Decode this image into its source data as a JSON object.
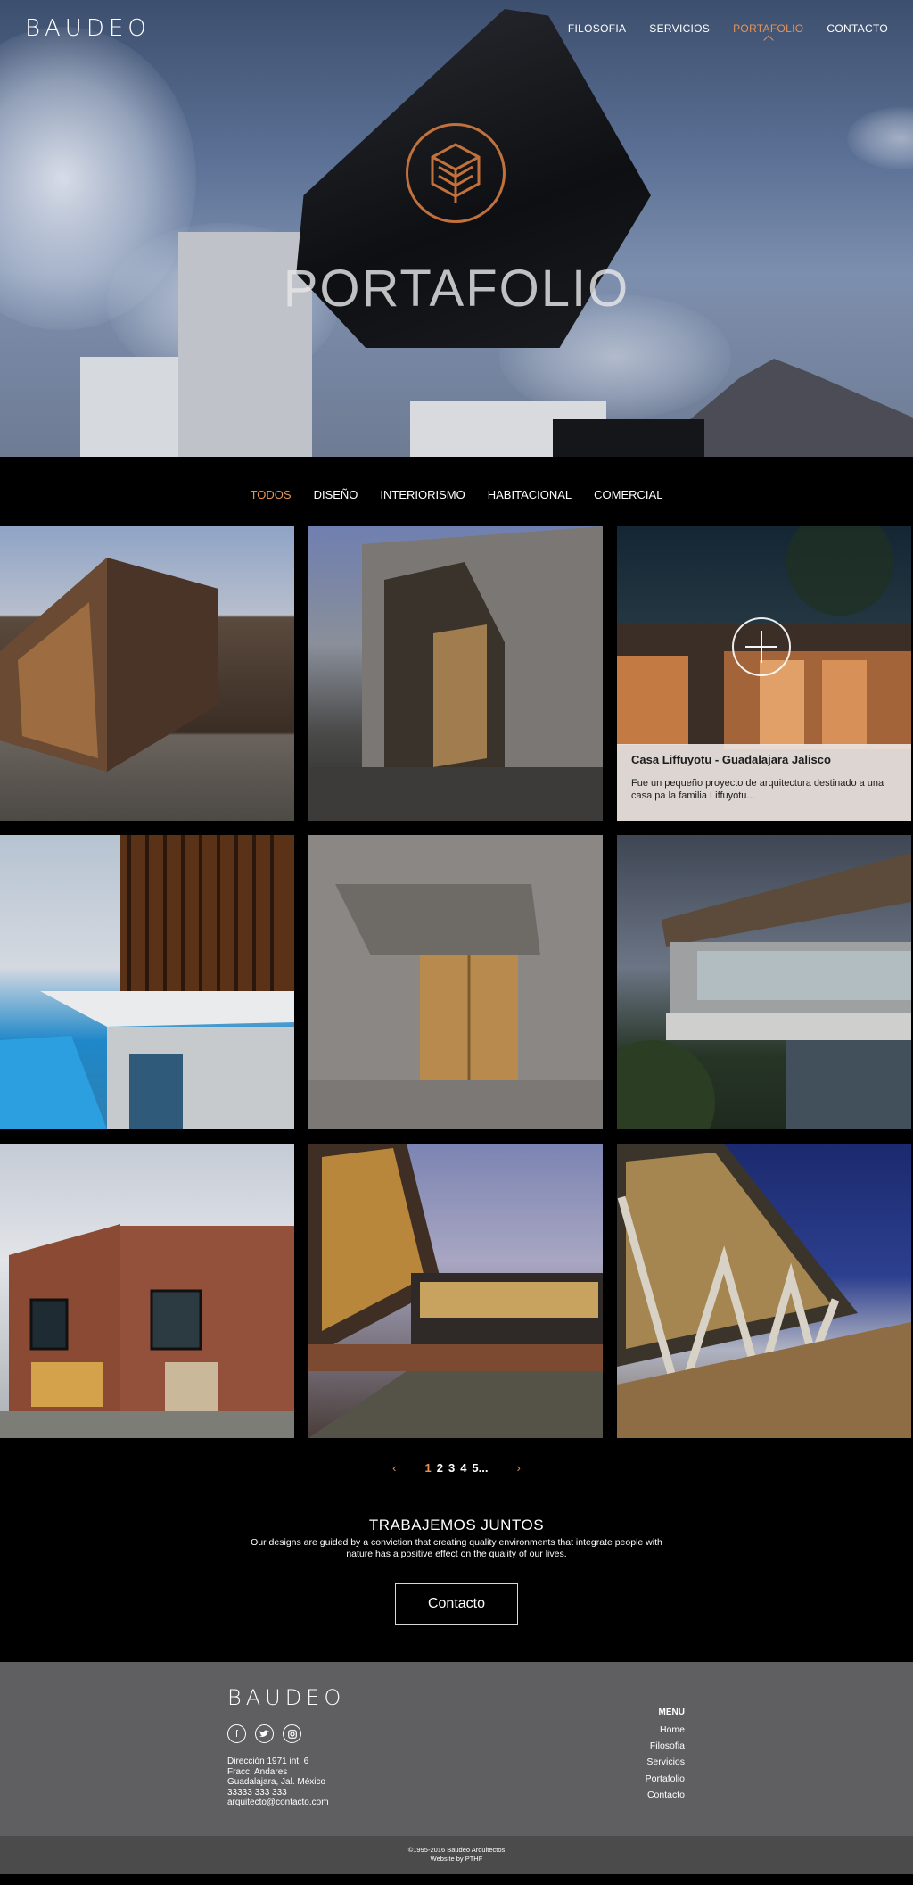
{
  "header": {
    "logo": "BAUDEO",
    "nav": [
      {
        "label": "FILOSOFIA",
        "active": false
      },
      {
        "label": "SERVICIOS",
        "active": false
      },
      {
        "label": "PORTAFOLIO",
        "active": true
      },
      {
        "label": "CONTACTO",
        "active": false
      }
    ]
  },
  "hero": {
    "title": "PORTAFOLIO",
    "emblem_icon": "leaf-cube-emblem"
  },
  "filters": [
    {
      "label": "TODOS",
      "active": true
    },
    {
      "label": "DISEÑO",
      "active": false
    },
    {
      "label": "INTERIORISMO",
      "active": false
    },
    {
      "label": "HABITACIONAL",
      "active": false
    },
    {
      "label": "COMERCIAL",
      "active": false
    }
  ],
  "projects": {
    "featured": {
      "title": "Casa Liffuyotu - Guadalajara Jalisco",
      "description": "Fue un pequeño proyecto de arquitectura destinado a una casa pa la familia Liffuyotu..."
    }
  },
  "pagination": {
    "prev": "‹",
    "next": "›",
    "pages": [
      "1",
      "2",
      "3",
      "4",
      "5"
    ],
    "ellipsis": "...",
    "current": "1"
  },
  "cta": {
    "title": "TRABAJEMOS JUNTOS",
    "text": "Our designs are guided by a conviction that creating quality environments that integrate people with nature has a positive effect on the quality of our lives.",
    "button": "Contacto"
  },
  "footer": {
    "logo": "BAUDEO",
    "social": [
      "facebook-icon",
      "twitter-icon",
      "instagram-icon"
    ],
    "address": [
      "Dirección 1971 int. 6",
      "Fracc. Andares",
      "Guadalajara, Jal. México",
      "33333 333 333",
      "arquitecto@contacto.com"
    ],
    "menu_title": "MENU",
    "menu": [
      "Home",
      "Filosofia",
      "Servicios",
      "Portafolio",
      "Contacto"
    ],
    "copyright": "©1995-2016 Baudeo Arquitectos",
    "credit": "Website by PTHF"
  },
  "colors": {
    "accent": "#e3935a",
    "emblem": "#c2703c",
    "footer_bg": "#5f5f61",
    "legal_bg": "#4b4b4c"
  }
}
